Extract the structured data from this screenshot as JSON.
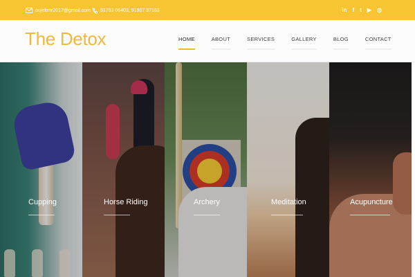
{
  "colors": {
    "accent": "#f7c531",
    "logo": "#f2b83a"
  },
  "topbar": {
    "email": "oujeltrnr2017@gmail.com",
    "phone": "91763 06403, 91907 37163",
    "social_icons": [
      "linkedin-icon",
      "facebook-icon",
      "twitter-icon",
      "youtube-icon",
      "instagram-icon"
    ],
    "social_glyphs": {
      "linkedin": "in",
      "facebook": "f",
      "twitter": "t",
      "youtube": "▶",
      "instagram": "◎"
    }
  },
  "header": {
    "logo": "The Detox",
    "menu": [
      {
        "label": "HOME",
        "active": true
      },
      {
        "label": "ABOUT"
      },
      {
        "label": "SERVICES"
      },
      {
        "label": "GALLERY"
      },
      {
        "label": "BLOG"
      },
      {
        "label": "CONTACT"
      }
    ]
  },
  "services": [
    {
      "label": "Cupping"
    },
    {
      "label": "Horse Riding"
    },
    {
      "label": "Archery"
    },
    {
      "label": "Meditation"
    },
    {
      "label": "Acupuncture"
    }
  ]
}
